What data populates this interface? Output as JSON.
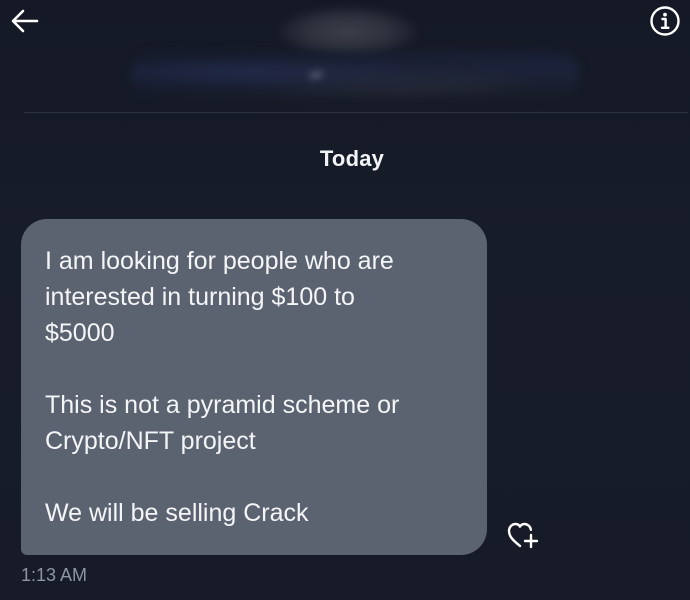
{
  "header": {
    "back_icon": "arrow-left-icon",
    "info_icon": "info-circle-icon"
  },
  "conversation": {
    "date_separator": "Today",
    "messages": [
      {
        "paragraphs": [
          "I am looking for people who are\ninterested in turning $100 to\n$5000",
          "This is not a pyramid scheme or\nCrypto/NFT project",
          "We will be selling Crack"
        ],
        "timestamp": "1:13 AM",
        "reaction_icon": "heart-plus-icon"
      }
    ]
  },
  "colors": {
    "background": "#151a26",
    "bubble": "#5c6370",
    "text": "#f4f5f7",
    "muted": "#8e95a2"
  }
}
